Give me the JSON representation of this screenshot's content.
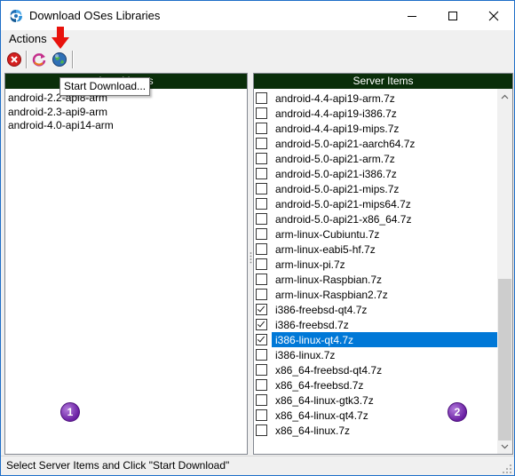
{
  "window": {
    "title": "Download OSes Libraries",
    "minimize_icon": "minimize-icon",
    "maximize_icon": "maximize-icon",
    "close_icon": "close-icon"
  },
  "menu": {
    "actions_label": "Actions"
  },
  "toolbar": {
    "buttons": [
      {
        "icon": "stop-icon"
      },
      {
        "icon": "refresh-icon"
      },
      {
        "icon": "globe-download-icon"
      }
    ],
    "tooltip": "Start Download..."
  },
  "local_panel": {
    "header": "Local Items",
    "items": [
      "android-2.2-api8-arm",
      "android-2.3-api9-arm",
      "android-4.0-api14-arm"
    ],
    "badge": "1"
  },
  "server_panel": {
    "header": "Server Items",
    "items": [
      {
        "label": "android-4.4-api19-arm.7z",
        "checked": false,
        "selected": false
      },
      {
        "label": "android-4.4-api19-i386.7z",
        "checked": false,
        "selected": false
      },
      {
        "label": "android-4.4-api19-mips.7z",
        "checked": false,
        "selected": false
      },
      {
        "label": "android-5.0-api21-aarch64.7z",
        "checked": false,
        "selected": false
      },
      {
        "label": "android-5.0-api21-arm.7z",
        "checked": false,
        "selected": false
      },
      {
        "label": "android-5.0-api21-i386.7z",
        "checked": false,
        "selected": false
      },
      {
        "label": "android-5.0-api21-mips.7z",
        "checked": false,
        "selected": false
      },
      {
        "label": "android-5.0-api21-mips64.7z",
        "checked": false,
        "selected": false
      },
      {
        "label": "android-5.0-api21-x86_64.7z",
        "checked": false,
        "selected": false
      },
      {
        "label": "arm-linux-Cubiuntu.7z",
        "checked": false,
        "selected": false
      },
      {
        "label": "arm-linux-eabi5-hf.7z",
        "checked": false,
        "selected": false
      },
      {
        "label": "arm-linux-pi.7z",
        "checked": false,
        "selected": false
      },
      {
        "label": "arm-linux-Raspbian.7z",
        "checked": false,
        "selected": false
      },
      {
        "label": "arm-linux-Raspbian2.7z",
        "checked": false,
        "selected": false
      },
      {
        "label": "i386-freebsd-qt4.7z",
        "checked": true,
        "selected": false
      },
      {
        "label": "i386-freebsd.7z",
        "checked": true,
        "selected": false
      },
      {
        "label": "i386-linux-qt4.7z",
        "checked": true,
        "selected": true
      },
      {
        "label": "i386-linux.7z",
        "checked": false,
        "selected": false
      },
      {
        "label": "x86_64-freebsd-qt4.7z",
        "checked": false,
        "selected": false
      },
      {
        "label": "x86_64-freebsd.7z",
        "checked": false,
        "selected": false
      },
      {
        "label": "x86_64-linux-gtk3.7z",
        "checked": false,
        "selected": false
      },
      {
        "label": "x86_64-linux-qt4.7z",
        "checked": false,
        "selected": false
      },
      {
        "label": "x86_64-linux.7z",
        "checked": false,
        "selected": false
      }
    ],
    "badge": "2",
    "scroll_position": 0.45
  },
  "status": {
    "text": "Select Server Items and Click \"Start Download\""
  },
  "colors": {
    "panel_header_bg": "#0a2e0a",
    "selection": "#0078d7",
    "badge": "#6a1fa3",
    "annotation_arrow": "#e8120c"
  }
}
